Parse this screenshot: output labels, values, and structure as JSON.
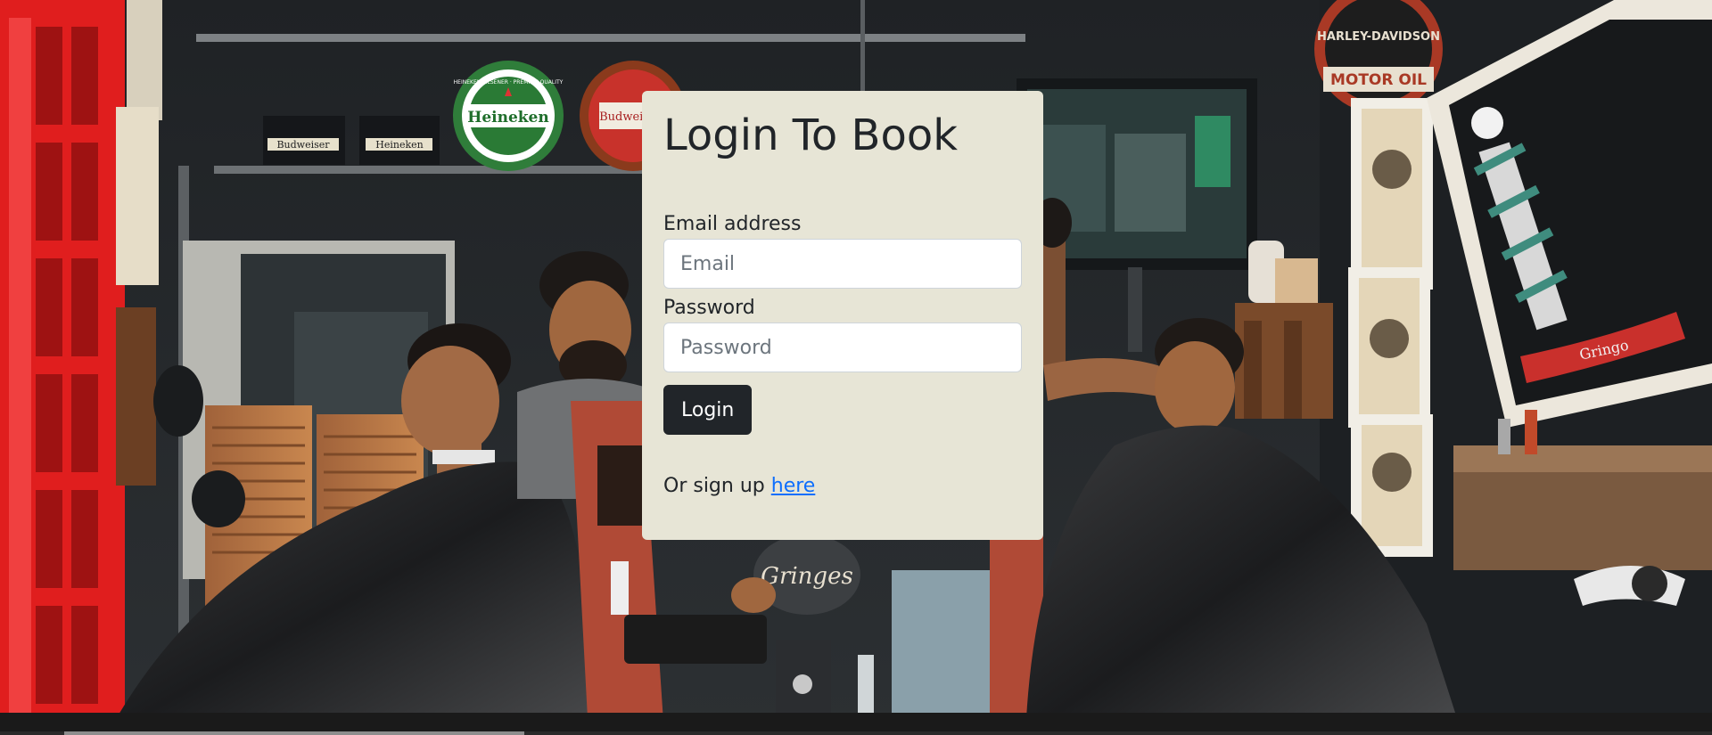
{
  "login": {
    "title": "Login To Book",
    "email_label": "Email address",
    "email_placeholder": "Email",
    "password_label": "Password",
    "password_placeholder": "Password",
    "login_button": "Login",
    "signup_prefix": "Or sign up",
    "signup_link": "here"
  },
  "background": {
    "signs": {
      "heineken_cap": "Heineken",
      "heineken_cap_ring": "HEINEKEN PILSENER · PREMIUM QUALITY",
      "budweiser_small": "Budweiser",
      "heineken_small": "Heineken",
      "budweiser_round": "Budweiser",
      "harley": "HARLEY-DAVIDSON",
      "harley_bottom": "MOTOR OIL",
      "storefront": "Gringes",
      "barber_plaque": "Gringo"
    }
  },
  "colors": {
    "card_background": "#e7e5d6",
    "button_background": "#212529",
    "link": "#0d6efd",
    "wall": "#25282b",
    "phone_box": "#e01e1e"
  }
}
